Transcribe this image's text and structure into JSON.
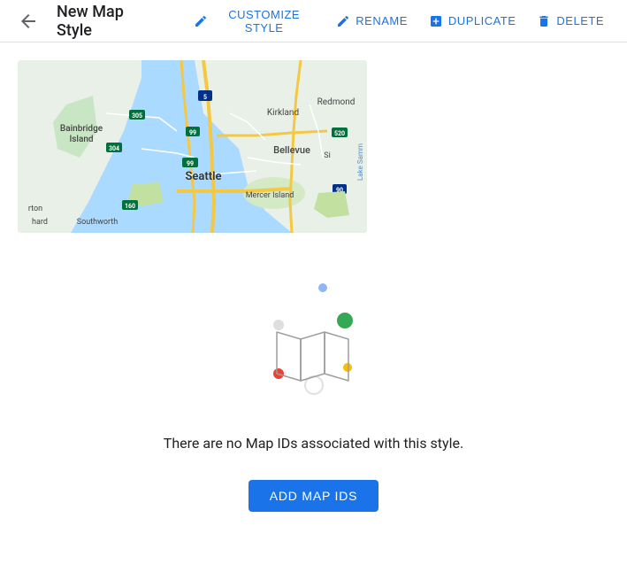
{
  "header": {
    "title": "New Map Style",
    "back_label": "back",
    "actions": [
      {
        "id": "customize",
        "label": "CUSTOMIZE STYLE",
        "icon": "pencil"
      },
      {
        "id": "rename",
        "label": "RENAME",
        "icon": "pencil"
      },
      {
        "id": "duplicate",
        "label": "DUPLICATE",
        "icon": "duplicate"
      },
      {
        "id": "delete",
        "label": "DELETE",
        "icon": "trash"
      }
    ]
  },
  "empty_state": {
    "message": "There are no Map IDs associated with this style.",
    "add_button_label": "ADD MAP IDS"
  },
  "colors": {
    "accent": "#1a73e8",
    "dot_green": "#34a853",
    "dot_red": "#ea4335",
    "dot_yellow": "#fbbc04",
    "dot_blue": "#4285f4"
  }
}
